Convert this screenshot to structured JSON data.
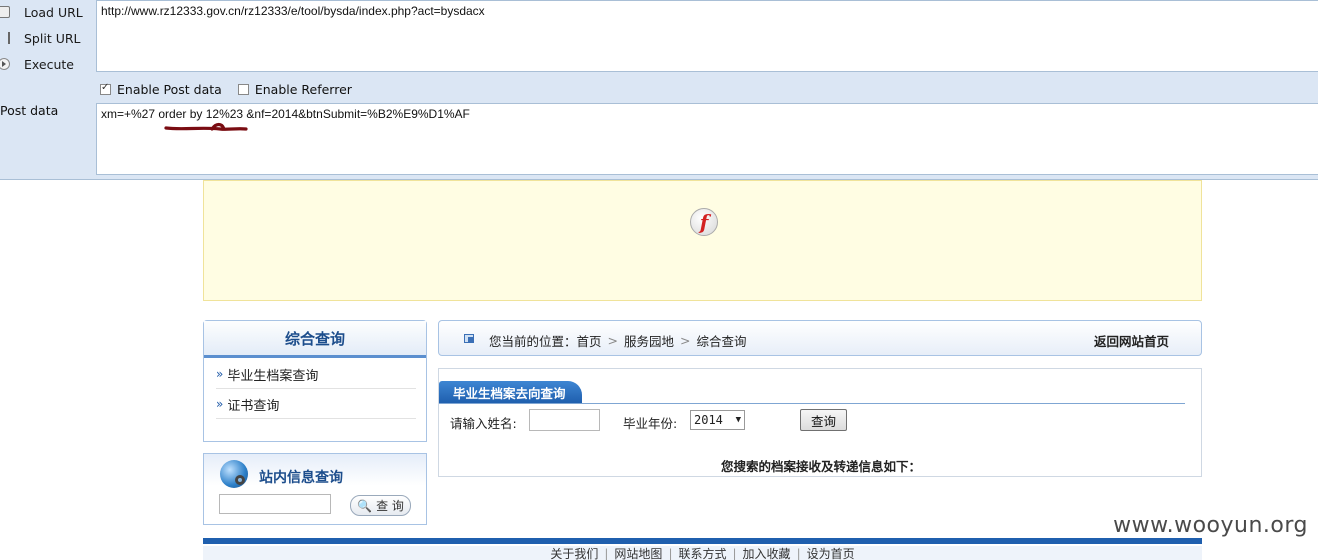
{
  "hackbar": {
    "load_url_label": "Load URL",
    "split_url_label": "Split URL",
    "execute_label": "Execute",
    "url_value": "http://www.rz12333.gov.cn/rz12333/e/tool/bysda/index.php?act=bysdacx",
    "enable_post_label": "Enable Post data",
    "enable_post_checked": true,
    "enable_referrer_label": "Enable Referrer",
    "enable_referrer_checked": false,
    "post_data_label": "Post data",
    "post_data_value": "xm=+%27 order by 12%23 &nf=2014&btnSubmit=%B2%E9%D1%AF",
    "scribble_color": "#7a0c12"
  },
  "left_menu": {
    "title": "综合查询",
    "items": [
      {
        "label": "毕业生档案查询"
      },
      {
        "label": "证书查询"
      }
    ]
  },
  "site_search": {
    "title": "站内信息查询",
    "button_label": "查 询"
  },
  "breadcrumb": {
    "prefix": "您当前的位置：",
    "items": [
      "首页",
      "服务园地",
      "综合查询"
    ],
    "home_link": "返回网站首页"
  },
  "query": {
    "tab_title": "毕业生档案去向查询",
    "name_label": "请输入姓名:",
    "year_label": "毕业年份:",
    "year_value": "2014",
    "submit_label": "查询",
    "result_text": "您搜索的档案接收及转递信息如下："
  },
  "footer": {
    "links": [
      "关于我们",
      "网站地图",
      "联系方式",
      "加入收藏",
      "设为首页"
    ]
  },
  "watermark": "www.wooyun.org",
  "colors": {
    "accent": "#1f5fae",
    "hackbar_bg": "#dbe6f4",
    "banner_bg": "#fffde3"
  }
}
